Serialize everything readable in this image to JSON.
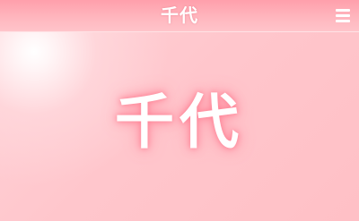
{
  "header": {
    "title": "千代",
    "menu_icon": "hamburger-menu-icon"
  },
  "hero": {
    "title": "千代"
  },
  "colors": {
    "header_top": "#ff9fab",
    "background": "#ffc3c9",
    "text": "#ffffff",
    "glow": "#ff8fa0"
  }
}
